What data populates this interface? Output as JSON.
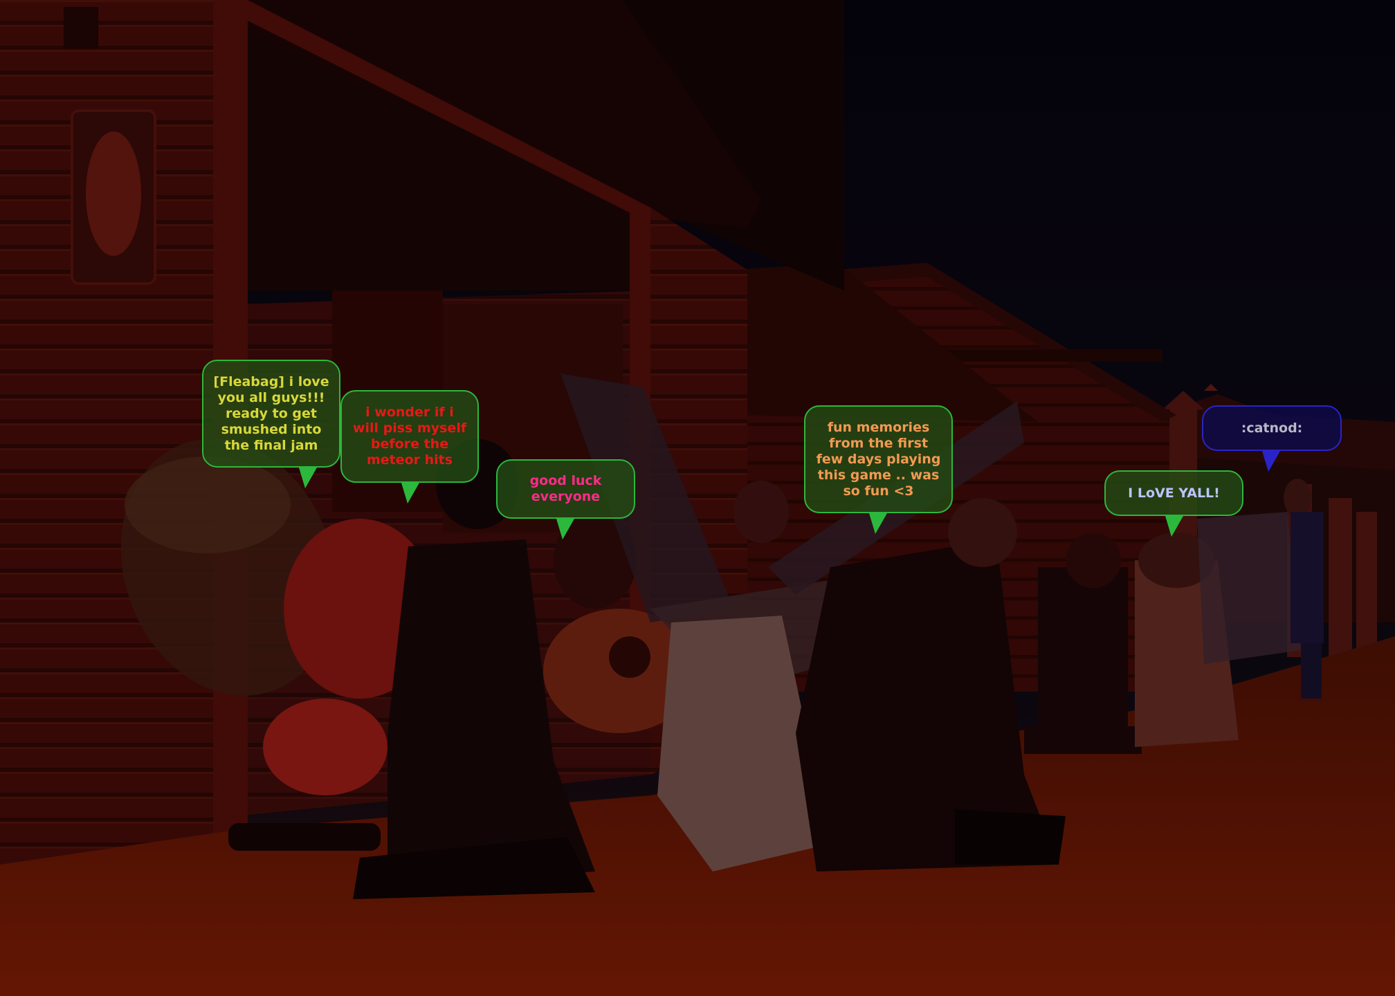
{
  "scene": {
    "description_color_tint": "#3a0804",
    "sky_color": "#07050f",
    "ground_color": "#6e1804"
  },
  "chat_bubbles": [
    {
      "text": "[Fleabag] i love you all guys!!! ready to get smushed into the final jam",
      "text_color": "#d8d83a",
      "style": "green"
    },
    {
      "text": "i wonder if i will piss myself before the meteor hits",
      "text_color": "#e81818",
      "style": "green"
    },
    {
      "text": "good luck everyone",
      "text_color": "#ff2a8a",
      "style": "green"
    },
    {
      "text": "fun memories from the first few days playing this game .. was so fun <3",
      "text_color": "#f29a52",
      "style": "green"
    },
    {
      "text": "I LoVE YALL!",
      "text_color": "#bcc4ff",
      "style": "green"
    },
    {
      "text": ":catnod:",
      "text_color": "#b8b8c8",
      "style": "blue"
    }
  ]
}
